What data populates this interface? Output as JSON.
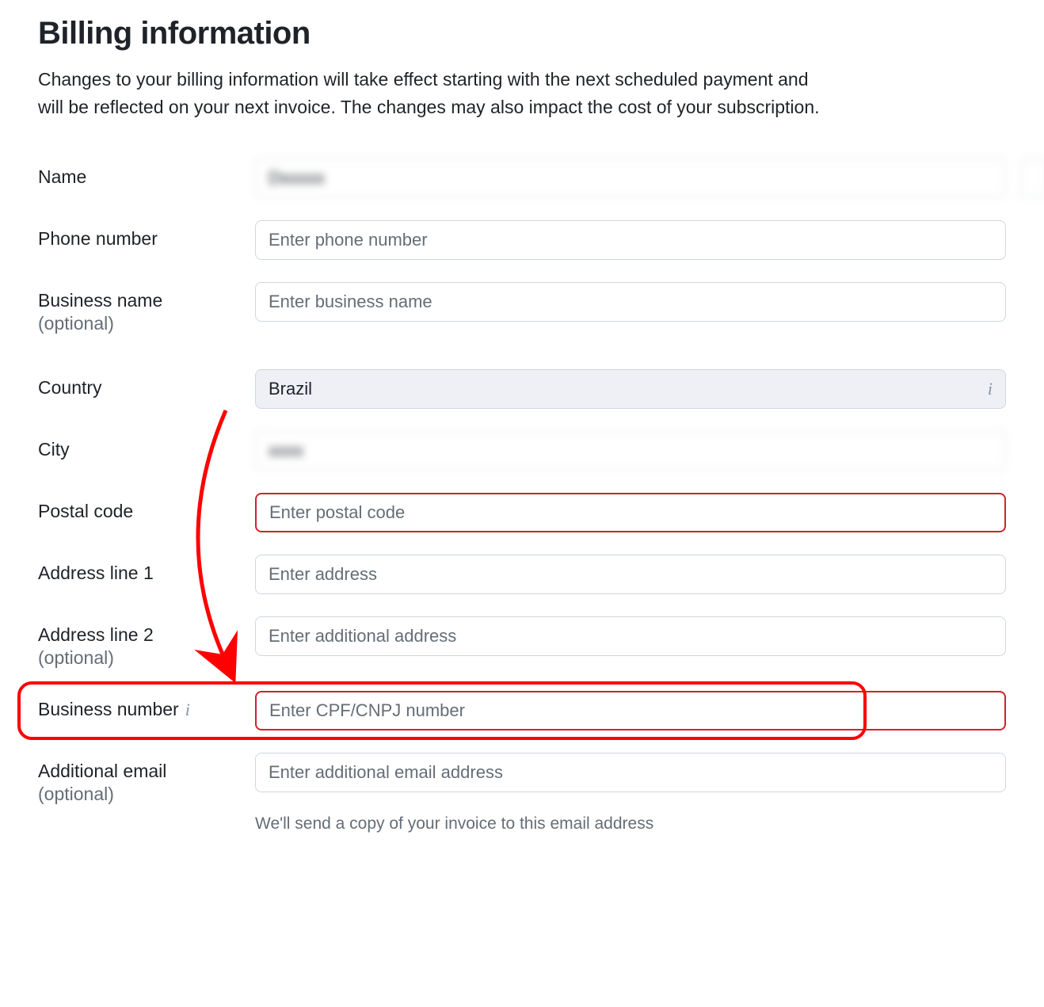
{
  "heading": "Billing information",
  "description": "Changes to your billing information will take effect starting with the next scheduled payment and will be reflected on your next invoice. The changes may also impact the cost of your subscription.",
  "fields": {
    "name": {
      "label": "Name",
      "first_value": "Dxxxxx",
      "last_value": "Axxxxxxxx"
    },
    "phone": {
      "label": "Phone number",
      "placeholder": "Enter phone number"
    },
    "business_name": {
      "label": "Business name",
      "sublabel": "(optional)",
      "placeholder": "Enter business name"
    },
    "country": {
      "label": "Country",
      "value": "Brazil"
    },
    "city": {
      "label": "City",
      "value": "xxxx"
    },
    "postal_code": {
      "label": "Postal code",
      "placeholder": "Enter postal code"
    },
    "address1": {
      "label": "Address line 1",
      "placeholder": "Enter address"
    },
    "address2": {
      "label": "Address line 2",
      "sublabel": "(optional)",
      "placeholder": "Enter additional address"
    },
    "business_number": {
      "label": "Business number",
      "placeholder": "Enter CPF/CNPJ number"
    },
    "additional_email": {
      "label": "Additional email",
      "sublabel": "(optional)",
      "placeholder": "Enter additional email address",
      "helper": "We'll send a copy of your invoice to this email address"
    }
  }
}
